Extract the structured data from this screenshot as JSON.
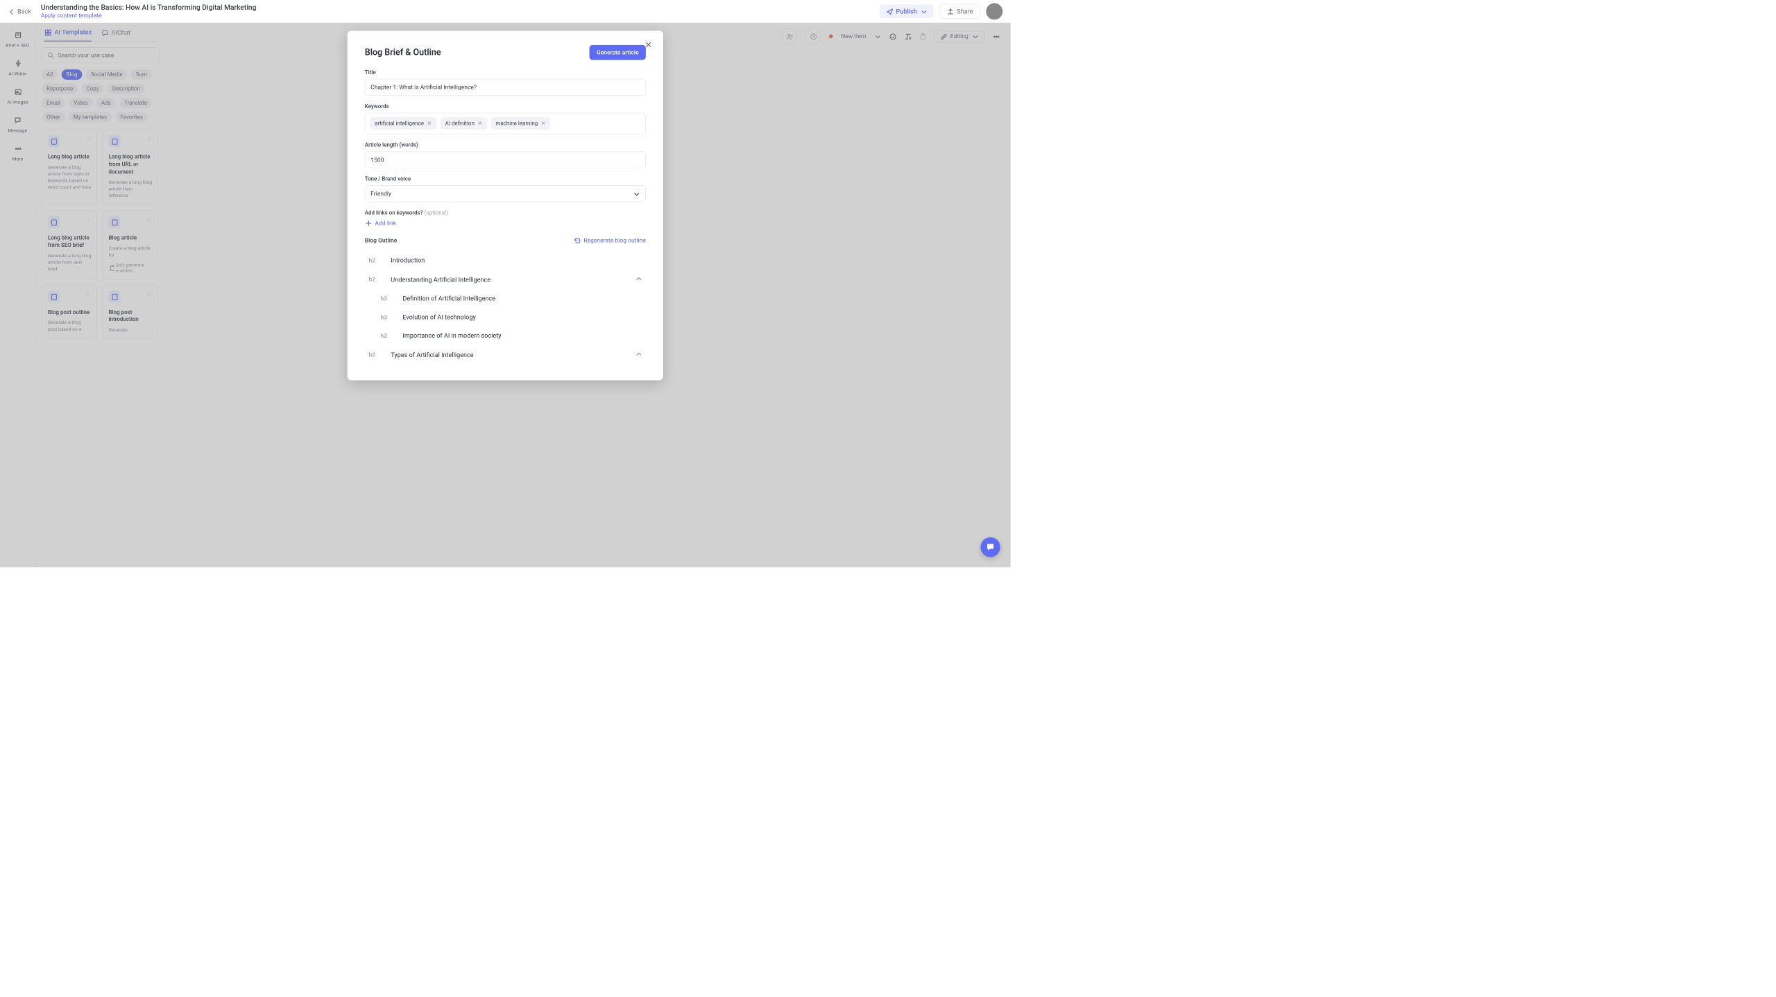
{
  "topbar": {
    "back": "Back",
    "doc_title": "Understanding the Basics: How AI is Transforming Digital Marketing",
    "apply_template": "Apply content template",
    "publish": "Publish",
    "share": "Share",
    "new_item": "New Item"
  },
  "rail": [
    {
      "label": "Brief + SEO"
    },
    {
      "label": "AI Writer"
    },
    {
      "label": "AI Images"
    },
    {
      "label": "Message"
    },
    {
      "label": "More"
    }
  ],
  "panel": {
    "tabs": {
      "templates": "AI Templates",
      "chat": "AIChat"
    },
    "search_placeholder": "Search your use case",
    "chips": [
      "All",
      "Blog",
      "Social Media",
      "Sum",
      "Repurpose",
      "Copy",
      "Description",
      "Email",
      "Video",
      "Ads",
      "Translate",
      "Other",
      "My templates",
      "Favorites"
    ],
    "cards": [
      {
        "title": "Long blog article",
        "desc": "Generate a blog article from topic or keywords based on word count and tone"
      },
      {
        "title": "Long blog article from URL or document",
        "desc": "Generate a long blog article from reference"
      },
      {
        "title": "Long blog article from SEO brief",
        "desc": "Generate a long blog article from SEO brief"
      },
      {
        "title": "Blog article",
        "desc": "Create a blog article for",
        "note": "Bulk generate enabled"
      },
      {
        "title": "Blog post outline",
        "desc": "Generate a blog post based on a"
      },
      {
        "title": "Blog post introduction",
        "desc": "Generate"
      }
    ]
  },
  "editor": {
    "editing_mode": "Editing"
  },
  "modal": {
    "title": "Blog Brief & Outline",
    "generate": "Generate article",
    "labels": {
      "title": "Title",
      "keywords": "Keywords",
      "length": "Article length (words)",
      "tone": "Tone / Brand voice",
      "links": "Add links on keywords?",
      "links_opt": "(optional)",
      "add_link": "Add link",
      "outline": "Blog Outline",
      "regenerate": "Regenerate blog outline"
    },
    "values": {
      "title": "Chapter 1: What is Artificial Intelligence?",
      "length": "1500",
      "tone": "Friendly"
    },
    "keywords": [
      "artificial intelligence",
      "AI definition",
      "machine learning"
    ],
    "outline": [
      {
        "level": "h2",
        "text": "Introduction"
      },
      {
        "level": "h2",
        "text": "Understanding Artificial Intelligence",
        "collapsible": true
      },
      {
        "level": "h3",
        "text": "Definition of Artificial Intelligence"
      },
      {
        "level": "h3",
        "text": "Evolution of AI technology"
      },
      {
        "level": "h3",
        "text": "Importance of AI in modern society"
      },
      {
        "level": "h2",
        "text": "Types of Artificial Intelligence",
        "collapsible": true
      }
    ]
  }
}
